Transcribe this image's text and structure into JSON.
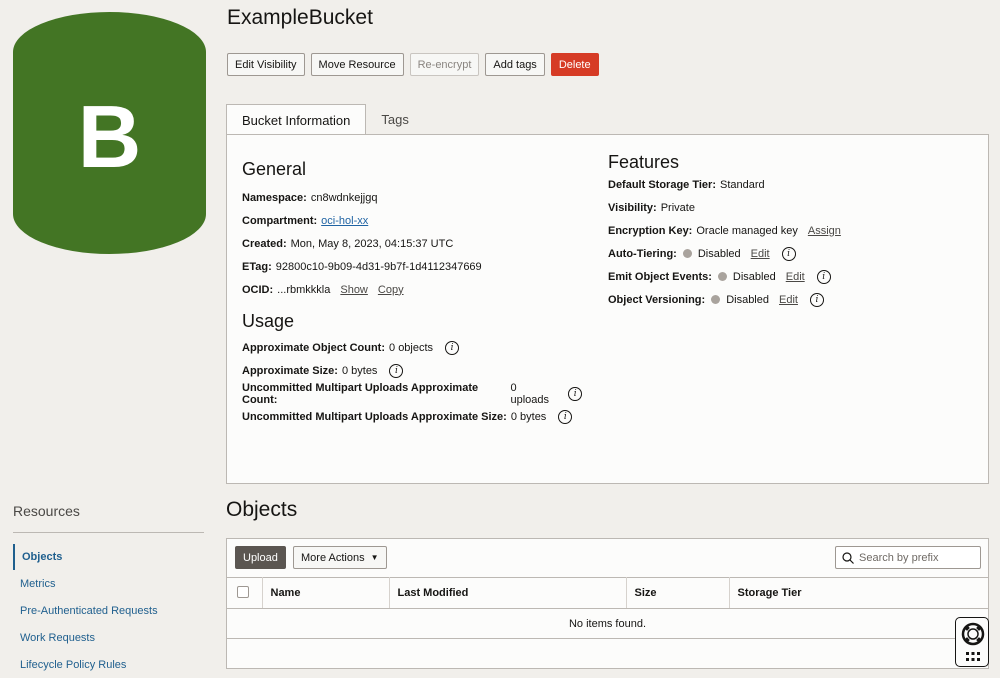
{
  "bucket": {
    "logo_letter": "B",
    "title": "ExampleBucket",
    "logo_color": "#437524"
  },
  "actions": {
    "edit_visibility": "Edit Visibility",
    "move_resource": "Move Resource",
    "reencrypt": "Re-encrypt",
    "add_tags": "Add tags",
    "delete": "Delete"
  },
  "tabs": {
    "info": "Bucket Information",
    "tags": "Tags"
  },
  "general": {
    "heading": "General",
    "namespace_label": "Namespace:",
    "namespace": "cn8wdnkejjgq",
    "compartment_label": "Compartment:",
    "compartment": "oci-hol-xx",
    "created_label": "Created:",
    "created": "Mon, May 8, 2023, 04:15:37 UTC",
    "etag_label": "ETag:",
    "etag": "92800c10-9b09-4d31-9b7f-1d4112347669",
    "ocid_label": "OCID:",
    "ocid": "...rbmkkkla",
    "show": "Show",
    "copy": "Copy"
  },
  "usage": {
    "heading": "Usage",
    "count_label": "Approximate Object Count:",
    "count": "0 objects",
    "size_label": "Approximate Size:",
    "size": "0 bytes",
    "mp_count_label": "Uncommitted Multipart Uploads Approximate Count:",
    "mp_count": "0 uploads",
    "mp_size_label": "Uncommitted Multipart Uploads Approximate Size:",
    "mp_size": "0 bytes"
  },
  "features": {
    "heading": "Features",
    "tier_label": "Default Storage Tier:",
    "tier": "Standard",
    "visibility_label": "Visibility:",
    "visibility": "Private",
    "enc_label": "Encryption Key:",
    "enc": "Oracle managed key",
    "assign": "Assign",
    "autotier_label": "Auto-Tiering:",
    "autotier": "Disabled",
    "events_label": "Emit Object Events:",
    "events": "Disabled",
    "versioning_label": "Object Versioning:",
    "versioning": "Disabled",
    "edit": "Edit"
  },
  "resources": {
    "title": "Resources",
    "items": [
      "Objects",
      "Metrics",
      "Pre-Authenticated Requests",
      "Work Requests",
      "Lifecycle Policy Rules"
    ]
  },
  "objects": {
    "heading": "Objects",
    "upload": "Upload",
    "more_actions": "More Actions",
    "search_placeholder": "Search by prefix",
    "columns": [
      "Name",
      "Last Modified",
      "Size",
      "Storage Tier"
    ],
    "empty": "No items found."
  }
}
